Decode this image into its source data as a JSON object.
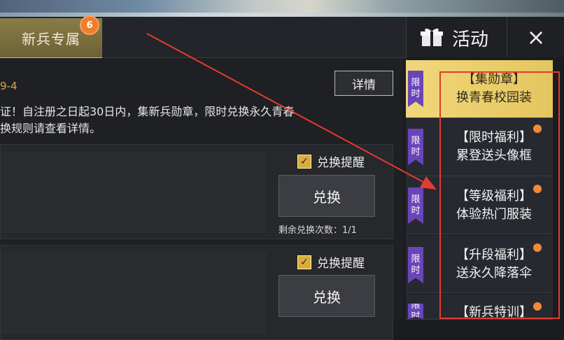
{
  "header": {
    "tab_label": "新兵专属",
    "tab_badge": "6",
    "panel_title": "活动",
    "close_symbol": "×"
  },
  "main": {
    "date_text": "9-4",
    "detail_button": "详情",
    "description_lines": [
      "证！自注册之日起30日内，集新兵勋章，限时兑换永久青春",
      "换规则请查看详情。"
    ],
    "cards": [
      {
        "remind_label": "兑换提醒",
        "exchange_button": "兑换",
        "remain_text": "剩余兑换次数：1/1"
      },
      {
        "remind_label": "兑换提醒",
        "exchange_button": "兑换"
      }
    ]
  },
  "sidebar": {
    "items": [
      {
        "flag": "限时",
        "title_line1": "【集勋章】",
        "title_line2": "换青春校园装",
        "dot": false,
        "active": true
      },
      {
        "flag": "限时",
        "title_line1": "【限时福利】",
        "title_line2": "累登送头像框",
        "dot": true,
        "active": false
      },
      {
        "flag": "限时",
        "title_line1": "【等级福利】",
        "title_line2": "体验热门服装",
        "dot": true,
        "active": false
      },
      {
        "flag": "限时",
        "title_line1": "【升段福利】",
        "title_line2": "送永久降落伞",
        "dot": true,
        "active": false
      },
      {
        "flag": "限时",
        "title_line1": "【新兵特训】",
        "title_line2": "",
        "dot": true,
        "active": false
      }
    ]
  },
  "icons": {
    "gift": "gift-icon",
    "close": "close-icon",
    "checkbox": "checkbox-checked-icon",
    "arrow": "red-arrow-annotation-icon"
  },
  "colors": {
    "accent_gold": "#e1c14a",
    "badge_orange": "#f17c2c",
    "flag_purple": "#6a45b8",
    "annotation_red": "#e23b31"
  }
}
